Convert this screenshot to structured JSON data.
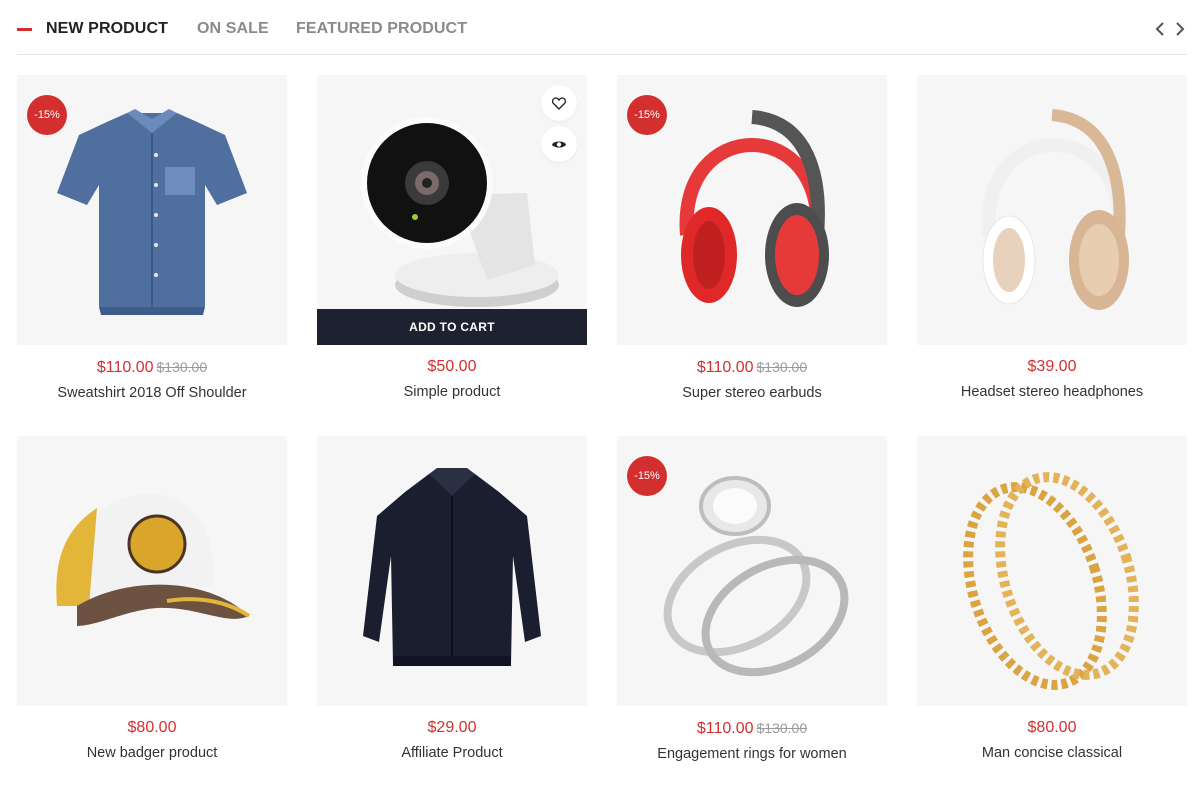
{
  "tabs": [
    {
      "label": "NEW PRODUCT",
      "active": true
    },
    {
      "label": "ON SALE",
      "active": false
    },
    {
      "label": "FEATURED PRODUCT",
      "active": false
    }
  ],
  "icons": {
    "prev": "chevron-left-icon",
    "next": "chevron-right-icon",
    "wishlist": "heart-icon",
    "quick_view": "eye-icon"
  },
  "colors": {
    "accent": "#d32f2f",
    "cart_bar": "#1d2130",
    "thumb_bg": "#f6f6f6"
  },
  "hover_card": {
    "add_to_cart_label": "ADD TO CART"
  },
  "products": [
    {
      "name": "Sweatshirt 2018 Off Shoulder",
      "price": "$110.00",
      "old_price": "$130.00",
      "badge": "-15%",
      "image": "denim-shirt"
    },
    {
      "name": "Simple product",
      "price": "$50.00",
      "old_price": "",
      "badge": "",
      "image": "security-camera"
    },
    {
      "name": "Super stereo earbuds",
      "price": "$110.00",
      "old_price": "$130.00",
      "badge": "-15%",
      "image": "red-headphones"
    },
    {
      "name": "Headset stereo headphones",
      "price": "$39.00",
      "old_price": "",
      "badge": "",
      "image": "gold-headphones"
    },
    {
      "name": "New badger product",
      "price": "$80.00",
      "old_price": "",
      "badge": "",
      "image": "baseball-cap"
    },
    {
      "name": "Affiliate Product",
      "price": "$29.00",
      "old_price": "",
      "badge": "",
      "image": "black-jacket"
    },
    {
      "name": "Engagement rings for women",
      "price": "$110.00",
      "old_price": "$130.00",
      "badge": "-15%",
      "image": "diamond-rings"
    },
    {
      "name": "Man concise classical",
      "price": "$80.00",
      "old_price": "",
      "badge": "",
      "image": "gold-bangles"
    }
  ]
}
